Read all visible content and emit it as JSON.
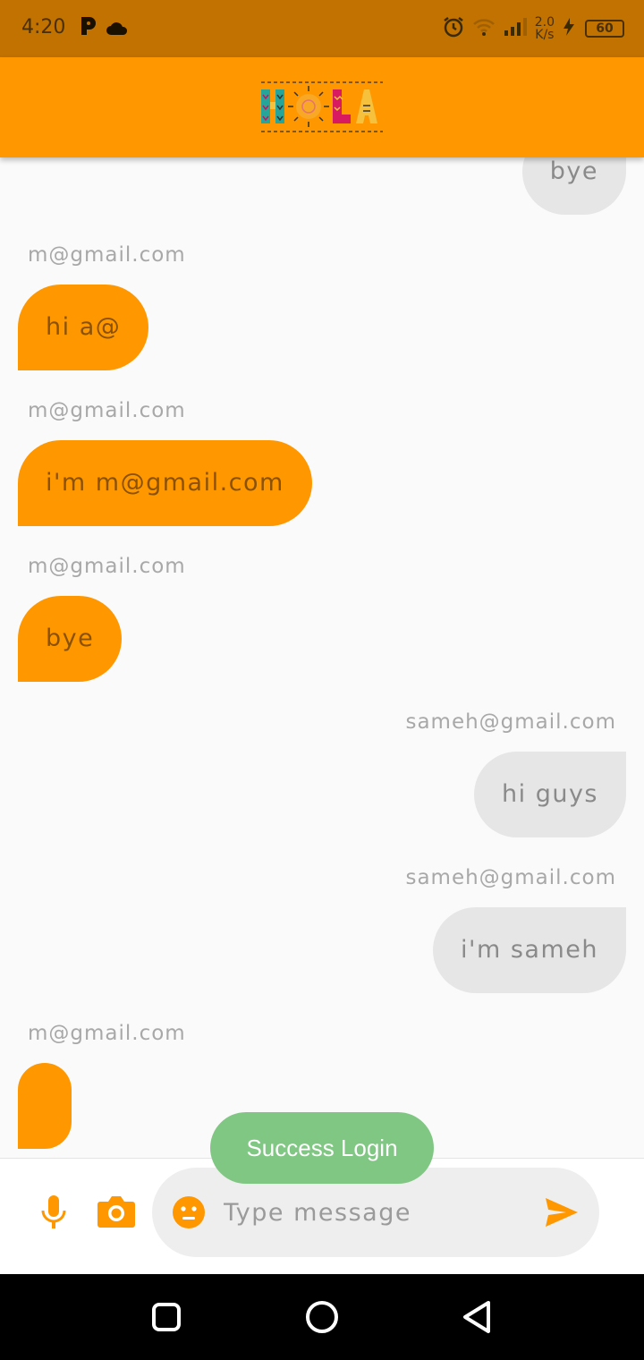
{
  "status_bar": {
    "time": "4:20",
    "network_speed_value": "2.0",
    "network_speed_unit": "K/s",
    "battery": "60",
    "icons": [
      "parking-icon",
      "cloud-icon",
      "alarm-icon",
      "wifi-icon",
      "signal-icon",
      "charging-icon"
    ]
  },
  "app_bar": {
    "logo_text": "HOLA",
    "color": "#ff9800"
  },
  "messages": [
    {
      "direction": "outgoing",
      "sender": "",
      "text": "bye"
    },
    {
      "direction": "incoming",
      "sender": "m@gmail.com",
      "text": "hi a@"
    },
    {
      "direction": "incoming",
      "sender": "m@gmail.com",
      "text": "i'm m@gmail.com"
    },
    {
      "direction": "incoming",
      "sender": "m@gmail.com",
      "text": "bye"
    },
    {
      "direction": "outgoing",
      "sender": "sameh@gmail.com",
      "text": "hi guys"
    },
    {
      "direction": "outgoing",
      "sender": "sameh@gmail.com",
      "text": "i'm sameh"
    },
    {
      "direction": "incoming",
      "sender": "m@gmail.com",
      "text": ""
    }
  ],
  "composer": {
    "placeholder": "Type message",
    "value": ""
  },
  "toast": {
    "text": "Success Login"
  },
  "colors": {
    "accent": "#ff9800",
    "status_bar": "#c27200",
    "toast": "#81c784",
    "incoming_bubble": "#ff9800",
    "outgoing_bubble": "#e6e6e6"
  }
}
